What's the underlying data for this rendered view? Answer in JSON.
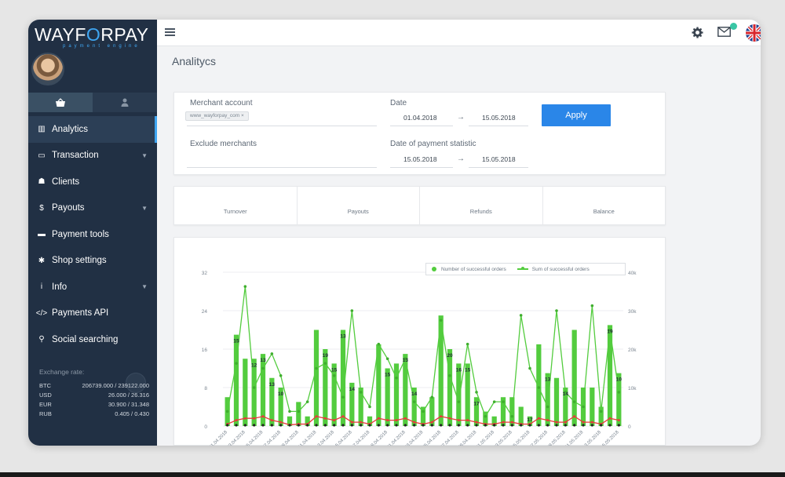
{
  "brand": {
    "name_pre": "WAYF",
    "name_mark": "O",
    "name_post": "RPAY",
    "tagline": "payment engine"
  },
  "sidebar": {
    "items": [
      {
        "label": "Analytics",
        "icon": "bar-chart-icon",
        "glyph": "▥",
        "active": true,
        "caret": false
      },
      {
        "label": "Transaction",
        "icon": "banknote-icon",
        "glyph": "▭",
        "active": false,
        "caret": true
      },
      {
        "label": "Clients",
        "icon": "user-icon",
        "glyph": "☗",
        "active": false,
        "caret": false
      },
      {
        "label": "Payouts",
        "icon": "dollar-icon",
        "glyph": "$",
        "active": false,
        "caret": true
      },
      {
        "label": "Payment tools",
        "icon": "credit-card-icon",
        "glyph": "▬",
        "active": false,
        "caret": false
      },
      {
        "label": "Shop settings",
        "icon": "gear-icon",
        "glyph": "✱",
        "active": false,
        "caret": false
      },
      {
        "label": "Info",
        "icon": "info-icon",
        "glyph": "i",
        "active": false,
        "caret": true
      },
      {
        "label": "Payments API",
        "icon": "code-icon",
        "glyph": "</>",
        "active": false,
        "caret": false
      },
      {
        "label": "Social searching",
        "icon": "search-icon",
        "glyph": "⚲",
        "active": false,
        "caret": false
      }
    ],
    "exchange_title": "Exchange rate:",
    "rates": [
      {
        "cur": "BTC",
        "val": "206739.000 / 239122.000"
      },
      {
        "cur": "USD",
        "val": "26.000 / 26.316"
      },
      {
        "cur": "EUR",
        "val": "30.900 / 31.348"
      },
      {
        "cur": "RUB",
        "val": "0.405 / 0.430"
      }
    ]
  },
  "header": {
    "title": "Analitycs",
    "messages_badge": "1"
  },
  "filters": {
    "merchant_label": "Merchant account",
    "merchant_chip": "www_wayforpay_com",
    "exclude_label": "Exclude merchants",
    "date_label": "Date",
    "date_from": "01.04.2018",
    "date_to": "15.05.2018",
    "payment_date_label": "Date of payment statistic",
    "payment_date_from": "15.05.2018",
    "payment_date_to": "15.05.2018",
    "apply_label": "Apply"
  },
  "stats": [
    "Turnover",
    "Payouts",
    "Refunds",
    "Balance"
  ],
  "chart_data": {
    "type": "bar",
    "legend": [
      "Number of successful orders",
      "Sum of successful orders"
    ],
    "legend_position": "top-right",
    "colors": {
      "bars": "#53cc3e",
      "line": "#53cc3e",
      "refund_line": "#e8393a"
    },
    "left_axis": {
      "ylim": [
        0,
        32
      ],
      "ticks": [
        "0",
        "8",
        "16",
        "24",
        "32"
      ]
    },
    "right_axis": {
      "ylim": [
        0,
        40
      ],
      "ticks": [
        "0",
        "10k",
        "20k",
        "30k",
        "40k"
      ]
    },
    "categories": [
      "01.04.2018",
      "02.04.2018",
      "03.04.2018",
      "04.04.2018",
      "05.04.2018",
      "06.04.2018",
      "07.04.2018",
      "08.04.2018",
      "09.04.2018",
      "10.04.2018",
      "11.04.2018",
      "12.04.2018",
      "13.04.2018",
      "14.04.2018",
      "15.04.2018",
      "16.04.2018",
      "17.04.2018",
      "18.04.2018",
      "19.04.2018",
      "20.04.2018",
      "21.04.2018",
      "22.04.2018",
      "23.04.2018",
      "24.04.2018",
      "25.04.2018",
      "26.04.2018",
      "27.04.2018",
      "28.04.2018",
      "29.04.2018",
      "30.04.2018",
      "01.05.2018",
      "02.05.2018",
      "03.05.2018",
      "04.05.2018",
      "05.05.2018",
      "06.05.2018",
      "07.05.2018",
      "08.05.2018",
      "09.05.2018",
      "10.05.2018",
      "11.05.2018",
      "12.05.2018",
      "13.05.2018",
      "14.05.2018",
      "15.05.2018"
    ],
    "x_tick_labels": [
      "01.04.2018",
      "03.04.2018",
      "05.04.2018",
      "07.04.2018",
      "09.04.2018",
      "11.04.2018",
      "13.04.2018",
      "15.04.2018",
      "17.04.2018",
      "19.04.2018",
      "21.04.2018",
      "23.04.2018",
      "25.04.2018",
      "27.04.2018",
      "29.04.2018",
      "01.05.2018",
      "03.05.2018",
      "05.05.2018",
      "07.05.2018",
      "09.05.2018",
      "11.05.2018",
      "13.05.2018",
      "15.05.2018"
    ],
    "series": [
      {
        "name": "Number of successful orders",
        "type": "bar",
        "axis": "left",
        "values": [
          6,
          19,
          14,
          14,
          15,
          10,
          8,
          2,
          5,
          2,
          20,
          16,
          13,
          20,
          9,
          8,
          2,
          17,
          12,
          13,
          15,
          8,
          4,
          6,
          23,
          16,
          13,
          13,
          6,
          3,
          2,
          6,
          6,
          4,
          2,
          17,
          11,
          10,
          8,
          20,
          8,
          8,
          4,
          21,
          11
        ]
      },
      {
        "name": "Sum of successful orders",
        "type": "line",
        "axis": "right",
        "values": [
          3.8,
          16.3,
          36.3,
          10.0,
          15.0,
          18.8,
          13.1,
          3.8,
          3.8,
          6.3,
          15.0,
          16.3,
          13.1,
          7.5,
          30.0,
          8.8,
          5.0,
          21.3,
          17.5,
          12.5,
          17.5,
          6.3,
          3.8,
          7.5,
          27.5,
          13.1,
          6.3,
          21.3,
          8.8,
          2.5,
          6.3,
          6.3,
          2.5,
          28.8,
          15.0,
          10.0,
          5.0,
          30.0,
          8.8,
          6.3,
          5.0,
          31.3,
          3.8,
          25.0,
          8.8
        ]
      },
      {
        "name": "Refunds",
        "type": "line",
        "axis": "right",
        "values": [
          0.5,
          1.5,
          2.0,
          2.0,
          2.5,
          1.5,
          1.0,
          0.3,
          0.5,
          0.5,
          2.5,
          2.0,
          1.5,
          2.5,
          1.0,
          1.0,
          0.5,
          2.0,
          1.5,
          1.5,
          2.0,
          1.0,
          0.5,
          1.0,
          2.5,
          2.0,
          1.5,
          1.5,
          1.0,
          0.5,
          0.5,
          1.0,
          1.0,
          0.5,
          0.5,
          2.0,
          1.5,
          1.0,
          1.0,
          2.5,
          1.0,
          1.0,
          0.5,
          2.0,
          1.5
        ]
      }
    ],
    "data_labels": [
      {
        "i": 1,
        "text": "15"
      },
      {
        "i": 3,
        "text": "12"
      },
      {
        "i": 4,
        "text": "13"
      },
      {
        "i": 5,
        "text": "13"
      },
      {
        "i": 6,
        "text": "10"
      },
      {
        "i": 11,
        "text": "19"
      },
      {
        "i": 12,
        "text": "15"
      },
      {
        "i": 13,
        "text": "13"
      },
      {
        "i": 14,
        "text": "14"
      },
      {
        "i": 18,
        "text": "15"
      },
      {
        "i": 20,
        "text": "13"
      },
      {
        "i": 21,
        "text": "14"
      },
      {
        "i": 25,
        "text": "20"
      },
      {
        "i": 26,
        "text": "16"
      },
      {
        "i": 27,
        "text": "15"
      },
      {
        "i": 28,
        "text": "17"
      },
      {
        "i": 34,
        "text": "17"
      },
      {
        "i": 36,
        "text": "13"
      },
      {
        "i": 38,
        "text": "14"
      },
      {
        "i": 43,
        "text": "19"
      },
      {
        "i": 44,
        "text": "10"
      }
    ]
  }
}
